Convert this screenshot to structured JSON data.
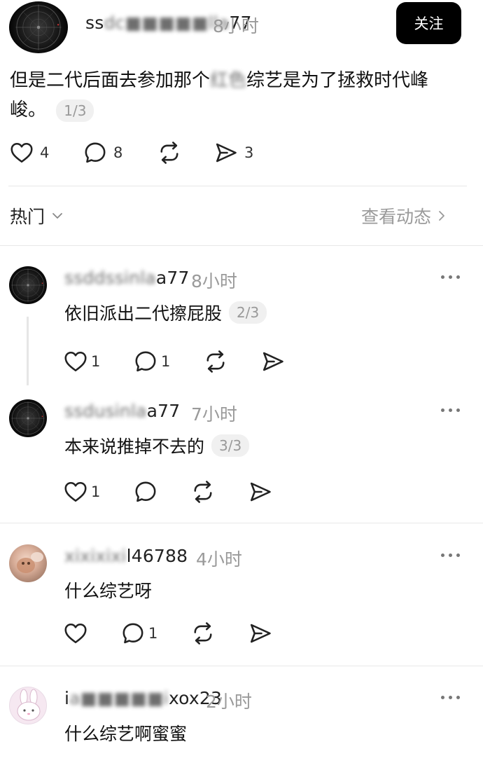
{
  "post": {
    "username_visible_start": "ss",
    "username_hidden": "dc■■■■■lla",
    "username_visible_end": "77",
    "time": "8小时",
    "follow_label": "关注",
    "text_part1": "但是二代后面去参加那个",
    "text_hidden": "红色",
    "text_part2": "综艺是为了拯救时代峰峻。",
    "page_tag": "1/3",
    "likes": "4",
    "comments": "8",
    "shares": "3"
  },
  "filter_bar": {
    "sort_label": "热门",
    "view_activity_label": "查看动态"
  },
  "comments": [
    {
      "username_hidden": "ssddssinla",
      "username_visible": "a77",
      "time": "8小时",
      "text": "依旧派出二代擦屁股",
      "page_tag": "2/3",
      "likes": "1",
      "replies": "1"
    },
    {
      "username_hidden": "ssdusinla",
      "username_visible": "a77",
      "time": "7小时",
      "text": "本来说推掉不去的",
      "page_tag": "3/3",
      "likes": "1",
      "replies": ""
    },
    {
      "username_hidden": "xixixixi",
      "username_visible": "l46788",
      "time": "4小时",
      "text": "什么综艺呀",
      "page_tag": "",
      "likes": "",
      "replies": "1"
    },
    {
      "username_visible_start": "i",
      "username_hidden": "a■■■■■i",
      "username_visible": "xox23",
      "time": "2小时",
      "text": "什么综艺啊蜜蜜",
      "page_tag": "",
      "likes": "",
      "replies": ""
    }
  ],
  "icons": {
    "like": "heart-icon",
    "reply": "comment-bubble-icon",
    "repost": "repost-icon",
    "share": "send-icon",
    "more": "more-dots-icon",
    "chevron_down": "chevron-down-icon",
    "chevron_right": "chevron-right-icon"
  },
  "colors": {
    "follow_button_bg": "#000000",
    "secondary_text": "#9a9a9a",
    "tag_bg": "#f0f0f0"
  }
}
